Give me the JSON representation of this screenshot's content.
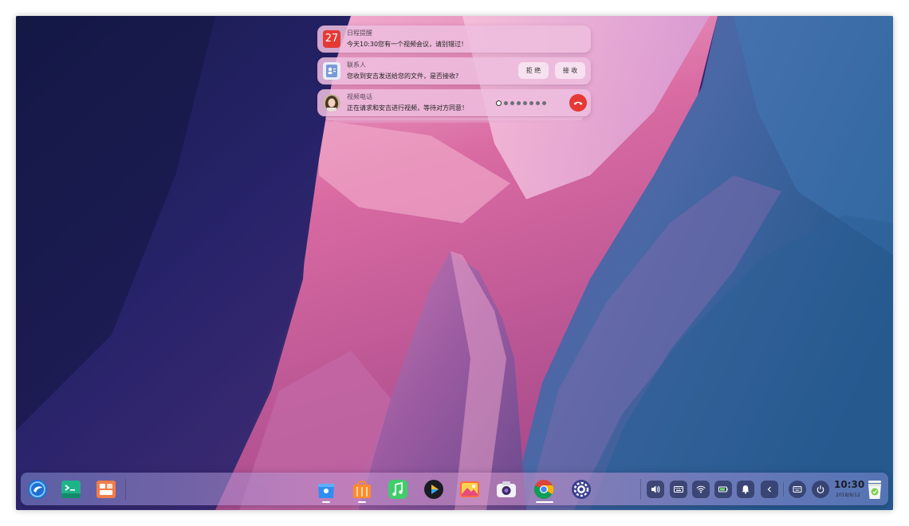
{
  "notifications": [
    {
      "app": "日程提醒",
      "body": "今天10:30您有一个视频会议，请别错过！",
      "icon": "calendar-icon",
      "calendar_day": "27"
    },
    {
      "app": "联系人",
      "body": "您收到安吉发送给您的文件，是否接收?",
      "icon": "contacts-icon",
      "reject_label": "拒 绝",
      "accept_label": "接 收"
    },
    {
      "app": "视频电话",
      "body": "正在请求和安吉进行视频，等待对方同意！",
      "icon": "avatar",
      "pager_total": 8,
      "pager_active": 1
    }
  ],
  "dock": {
    "left_apps": [
      "launcher-icon",
      "terminal-icon",
      "multitask-icon"
    ],
    "center_apps": [
      "app-store-icon",
      "deepin-store-icon",
      "music-icon",
      "movie-icon",
      "image-viewer-icon",
      "camera-icon",
      "chrome-icon",
      "settings-icon"
    ],
    "tray": [
      "volume-icon",
      "keyboard-icon",
      "wifi-icon",
      "battery-icon",
      "notification-bell-icon",
      "collapse-arrow-icon",
      "onscreen-keyboard-icon",
      "power-icon"
    ],
    "time": "10:30",
    "date": "2018/9/12",
    "trash": "trash-icon"
  },
  "colors": {
    "accent": "#e53935",
    "dock_button": "#2a3560",
    "notification_bg": "#eebfde"
  }
}
